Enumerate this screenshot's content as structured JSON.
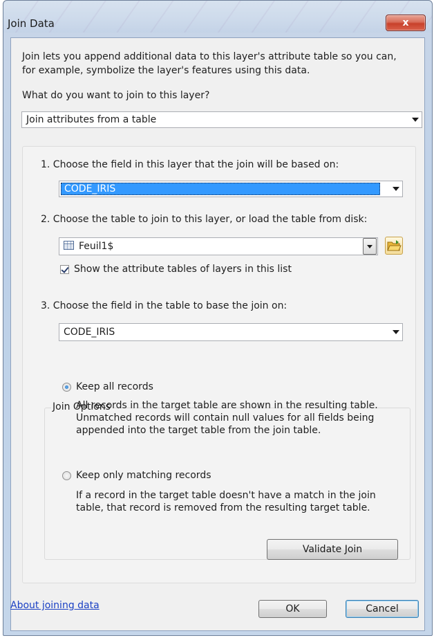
{
  "window": {
    "title": "Join Data",
    "close_glyph": "x"
  },
  "intro": {
    "line1": "Join lets you append additional data to this layer's attribute table so you can,",
    "line2": "for example, symbolize the layer's features using this data."
  },
  "join_type": {
    "question": "What do you want to join to this layer?",
    "selected": "Join attributes from a table"
  },
  "step1": {
    "label": "1.  Choose the field in this layer that the join will be based on:",
    "selected": "CODE_IRIS"
  },
  "step2": {
    "label": "2.  Choose the table to join to this layer, or load the table from disk:",
    "selected": "Feuil1$",
    "icon": "table-icon",
    "browse_icon": "open-folder-icon",
    "checkbox_label": "Show the attribute tables of layers in this list",
    "checkbox_checked": true
  },
  "step3": {
    "label": "3.  Choose the field in the table to base the join on:",
    "selected": "CODE_IRIS"
  },
  "join_options": {
    "legend": "Join Options",
    "keep_all": {
      "label": "Keep all records",
      "checked": true,
      "desc1": "All records in the target table are shown in the resulting table.",
      "desc2": "Unmatched records will contain null values for all fields being",
      "desc3": "appended into the target table from the join table."
    },
    "keep_matching": {
      "label": "Keep only matching records",
      "checked": false,
      "desc1": "If a record in the target table doesn't have a match in the join",
      "desc2": "table, that record is removed from the resulting target table."
    }
  },
  "buttons": {
    "validate": "Validate Join",
    "ok": "OK",
    "cancel": "Cancel"
  },
  "help_link": "About joining data"
}
